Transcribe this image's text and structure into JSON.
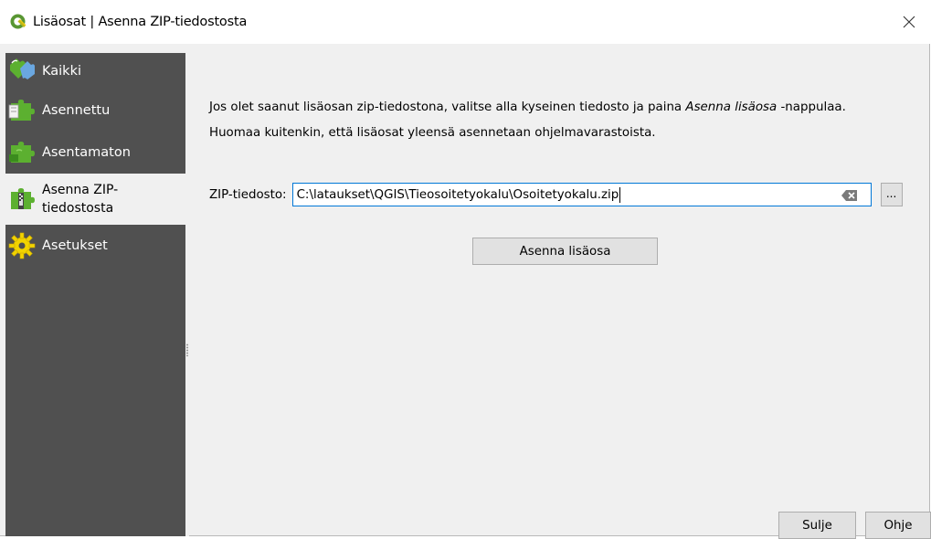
{
  "window": {
    "title": "Lisäosat | Asenna ZIP-tiedostosta",
    "app_icon": "qgis-logo-icon",
    "close_icon": "close-icon"
  },
  "sidebar": {
    "items": [
      {
        "label": "Kaikki",
        "icon": "puzzle-all-icon",
        "selected": false
      },
      {
        "label": "Asennettu",
        "icon": "puzzle-installed-icon",
        "selected": false
      },
      {
        "label": "Asentamaton",
        "icon": "puzzle-uninstalled-icon",
        "selected": false
      },
      {
        "label": "Asenna ZIP-\ntiedostosta",
        "label_line1": "Asenna ZIP-",
        "label_line2": "tiedostosta",
        "icon": "puzzle-zip-icon",
        "selected": true
      },
      {
        "label": "Asetukset",
        "icon": "gear-settings-icon",
        "selected": false
      }
    ]
  },
  "main": {
    "description_line1_a": "Jos olet saanut lisäosan zip-tiedostona, valitse alla kyseinen tiedosto ja paina ",
    "description_line1_em": "Asenna lisäosa",
    "description_line1_b": " -nappulaa.",
    "description_line2": "Huomaa kuitenkin, että lisäosat yleensä asennetaan ohjelmavarastoista.",
    "zip_label": "ZIP-tiedosto:",
    "zip_value": "C:\\lataukset\\QGIS\\Tieosoitetyokalu\\Osoitetyokalu.zip",
    "browse_label": "...",
    "install_label": "Asenna lisäosa"
  },
  "footer": {
    "close_label": "Sulje",
    "help_label": "Ohje"
  },
  "colors": {
    "sidebar_bg": "#505050",
    "panel_bg": "#f0f0f0",
    "input_focus": "#0078d7",
    "puzzle_green": "#5cb030",
    "qgis_green": "#589632",
    "qgis_yellow": "#eec90d"
  }
}
